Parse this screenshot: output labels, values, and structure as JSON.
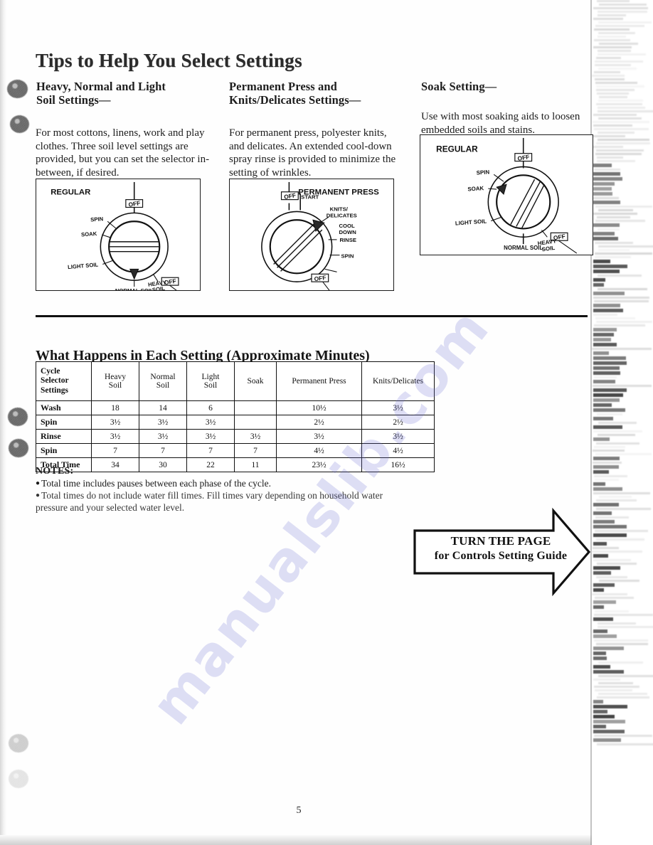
{
  "page": {
    "heading": "Tips to Help You Select Settings",
    "number": "5",
    "watermark": "manualslib.com"
  },
  "columns": [
    {
      "heading": "Heavy, Normal and Light\nSoil Settings—",
      "heading_line1": "Heavy, Normal and Light",
      "heading_line2": "Soil Settings—",
      "body": "For most cottons, linens, work and play clothes. Three soil level settings are provided, but you can set the selector in-between, if desired."
    },
    {
      "heading_line1": "Permanent Press and",
      "heading_line2": "Knits/Delicates Settings—",
      "body": "For permanent press, polyester knits, and delicates. An extended cool-down spray rinse is provided to minimize the setting of wrinkles."
    },
    {
      "heading_line1": "Soak Setting—",
      "heading_line2": "",
      "body": "Use with most soaking aids to loosen embedded soils and stains."
    }
  ],
  "figures": [
    {
      "name": "regular-dial-normal-soil",
      "title": "REGULAR",
      "labels": {
        "off_top": "OFF",
        "spin": "SPIN",
        "soak": "SOAK",
        "light_soil": "LIGHT SOIL",
        "normal_soil": "NORMAL SOIL",
        "heavy_soil_line1": "HEAVY",
        "heavy_soil_line2": "SOIL",
        "off_bottom": "OFF"
      }
    },
    {
      "name": "permanent-press-dial",
      "title": "PERMANENT PRESS",
      "labels": {
        "off_top": "OFF",
        "start": "START",
        "knits_line1": "KNITS/",
        "knits_line2": "DELICATES",
        "cool_line1": "COOL",
        "cool_line2": "DOWN",
        "rinse": "RINSE",
        "spin": "SPIN",
        "off_bottom": "OFF"
      }
    },
    {
      "name": "regular-dial-soak",
      "title": "REGULAR",
      "labels": {
        "off_top": "OFF",
        "spin": "SPIN",
        "soak": "SOAK",
        "light_soil": "LIGHT SOIL",
        "normal_soil": "NORMAL SOIL",
        "heavy_soil_line1": "HEAVY",
        "heavy_soil_line2": "SOIL",
        "off_bottom": "OFF"
      }
    }
  ],
  "table_section": {
    "heading": "What Happens in Each Setting (Approximate Minutes)",
    "headers": [
      "Cycle\nSelector\nSettings",
      "Heavy\nSoil",
      "Normal\nSoil",
      "Light\nSoil",
      "Soak",
      "Permanent Press",
      "Knits/Delicates"
    ],
    "headers_split": [
      [
        "Cycle",
        "Selector",
        "Settings"
      ],
      [
        "Heavy",
        "Soil"
      ],
      [
        "Normal",
        "Soil"
      ],
      [
        "Light",
        "Soil"
      ],
      [
        "Soak"
      ],
      [
        "Permanent Press"
      ],
      [
        "Knits/Delicates"
      ]
    ],
    "rows": [
      {
        "label": "Wash",
        "values": [
          "18",
          "14",
          "6",
          "",
          "10½",
          "3½"
        ]
      },
      {
        "label": "Spin",
        "values": [
          "3½",
          "3½",
          "3½",
          "",
          "2½",
          "2½"
        ]
      },
      {
        "label": "Rinse",
        "values": [
          "3½",
          "3½",
          "3½",
          "3½",
          "3½",
          "3½"
        ]
      },
      {
        "label": "Spin",
        "values": [
          "7",
          "7",
          "7",
          "7",
          "4½",
          "4½"
        ]
      },
      {
        "label": "Total Time",
        "values": [
          "34",
          "30",
          "22",
          "11",
          "23½",
          "16½"
        ]
      }
    ]
  },
  "notes": {
    "title": "NOTES:",
    "items": [
      "Total time includes pauses between each phase of the cycle.",
      "Total times do not include water fill times. Fill times vary depending on household water pressure and your selected water level."
    ]
  },
  "turn_arrow": {
    "line1": "TURN THE PAGE",
    "line2": "for Controls Setting Guide"
  }
}
